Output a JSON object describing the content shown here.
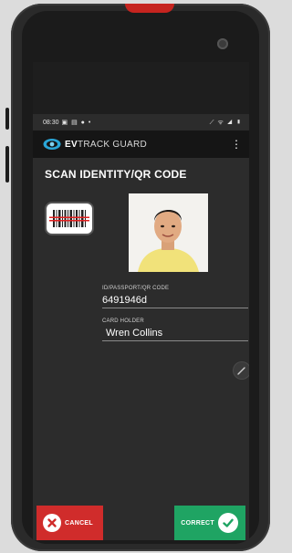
{
  "status_bar": {
    "time": "08:30",
    "left_icons": "▣ ▤ ● •",
    "right_icons": "⟋ ᯤ ◢ ▮"
  },
  "app_bar": {
    "logo_bold": "EV",
    "logo_light": "TRACK GUARD",
    "menu_icon": "⋮"
  },
  "page": {
    "title": "SCAN IDENTITY/QR CODE"
  },
  "fields": [
    {
      "label": "ID/PASSPORT/QR CODE",
      "value": "6491946d"
    },
    {
      "label": "CARD HOLDER",
      "value": "Wren Collins"
    }
  ],
  "actions": {
    "cancel_label": "CANCEL",
    "correct_label": "CORRECT"
  },
  "colors": {
    "cancel": "#d02c2b",
    "correct": "#1fa463",
    "appbar": "#151515",
    "screen_bg": "#2c2c2c",
    "device_accent": "#c6241f"
  }
}
